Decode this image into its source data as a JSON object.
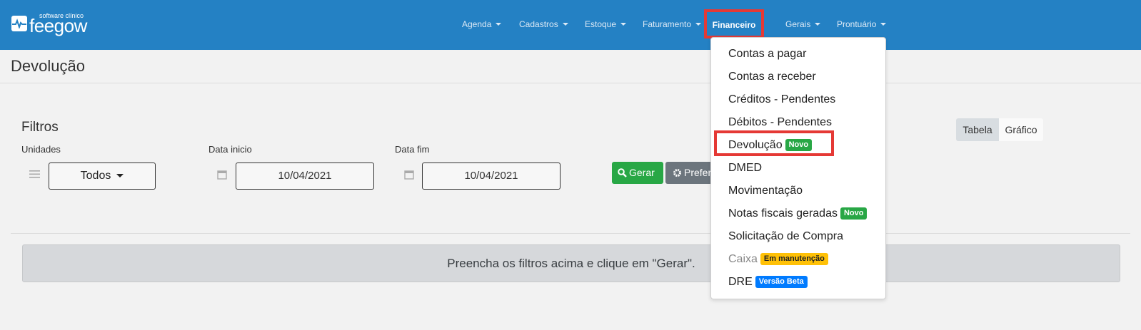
{
  "logo": {
    "small": "software clínico",
    "name": "feegow"
  },
  "nav": {
    "agenda": "Agenda",
    "cadastros": "Cadastros",
    "estoque": "Estoque",
    "faturamento": "Faturamento",
    "financeiro": "Financeiro",
    "gerais": "Gerais",
    "prontuario": "Prontuário"
  },
  "page": {
    "title": "Devolução"
  },
  "filters": {
    "heading": "Filtros",
    "unidades_label": "Unidades",
    "unidades_value": "Todos",
    "data_inicio_label": "Data inicio",
    "data_inicio_value": "10/04/2021",
    "data_fim_label": "Data fim",
    "data_fim_value": "10/04/2021",
    "gerar": "Gerar",
    "preferencias": "Prefer"
  },
  "view_toggle": {
    "tabela": "Tabela",
    "grafico": "Gráfico"
  },
  "notice": "Preencha os filtros acima e clique em \"Gerar\".",
  "dropdown": {
    "items": [
      {
        "label": "Contas a pagar"
      },
      {
        "label": "Contas a receber"
      },
      {
        "label": "Créditos - Pendentes"
      },
      {
        "label": "Débitos - Pendentes"
      },
      {
        "label": "Devolução",
        "badge": "Novo"
      },
      {
        "label": "DMED"
      },
      {
        "label": "Movimentação"
      },
      {
        "label": "Notas fiscais geradas",
        "badge": "Novo"
      },
      {
        "label": "Solicitação de Compra"
      },
      {
        "label": "Caixa",
        "badge": "Em manutenção"
      },
      {
        "label": "DRE",
        "badge": "Versão Beta"
      }
    ]
  },
  "colors": {
    "navbar": "#2481c4",
    "highlight": "#e53935",
    "success": "#28a745"
  }
}
